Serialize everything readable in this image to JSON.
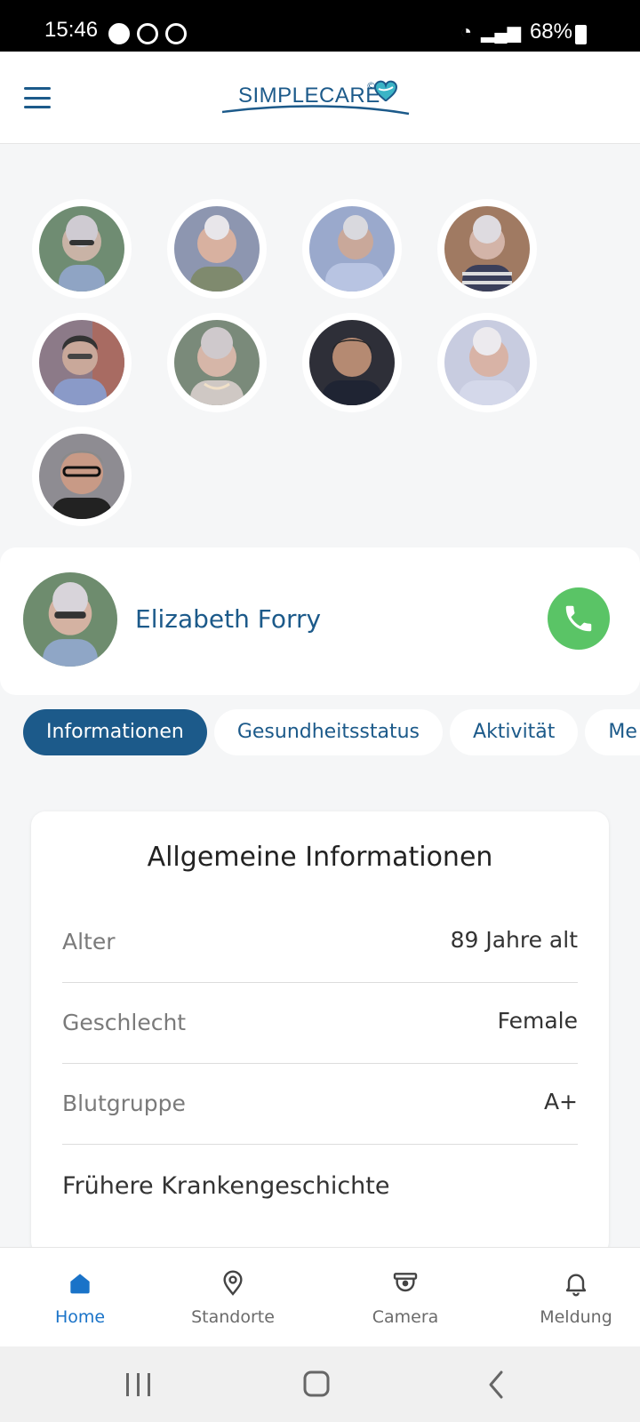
{
  "status_bar": {
    "time": "15:46",
    "battery": "68%"
  },
  "header": {
    "logo_text": "SIMPLECARE",
    "logo_mark": "©"
  },
  "residents": [
    {
      "name": "resident-1"
    },
    {
      "name": "resident-2"
    },
    {
      "name": "resident-3"
    },
    {
      "name": "resident-4"
    },
    {
      "name": "resident-5"
    },
    {
      "name": "resident-6"
    },
    {
      "name": "resident-7"
    },
    {
      "name": "resident-8"
    },
    {
      "name": "resident-9"
    }
  ],
  "profile": {
    "name": "Elizabeth Forry"
  },
  "tabs": [
    {
      "label": "Informationen",
      "active": true
    },
    {
      "label": "Gesundheitsstatus",
      "active": false
    },
    {
      "label": "Aktivität",
      "active": false
    },
    {
      "label": "Me",
      "active": false
    }
  ],
  "info": {
    "title": "Allgemeine Informationen",
    "rows": [
      {
        "label": "Alter",
        "value": "89 Jahre alt"
      },
      {
        "label": "Geschlecht",
        "value": "Female"
      },
      {
        "label": "Blutgruppe",
        "value": "A+"
      }
    ],
    "history_heading": "Frühere Krankengeschichte"
  },
  "bottom_nav": [
    {
      "label": "Home",
      "icon": "home-icon",
      "active": true
    },
    {
      "label": "Standorte",
      "icon": "location-pin-icon",
      "active": false
    },
    {
      "label": "Camera",
      "icon": "camera-icon",
      "active": false
    },
    {
      "label": "Meldung",
      "icon": "bell-icon",
      "active": false
    }
  ],
  "colors": {
    "primary": "#1c5a8a",
    "call": "#5ac466",
    "nav_active": "#1a73c8"
  }
}
